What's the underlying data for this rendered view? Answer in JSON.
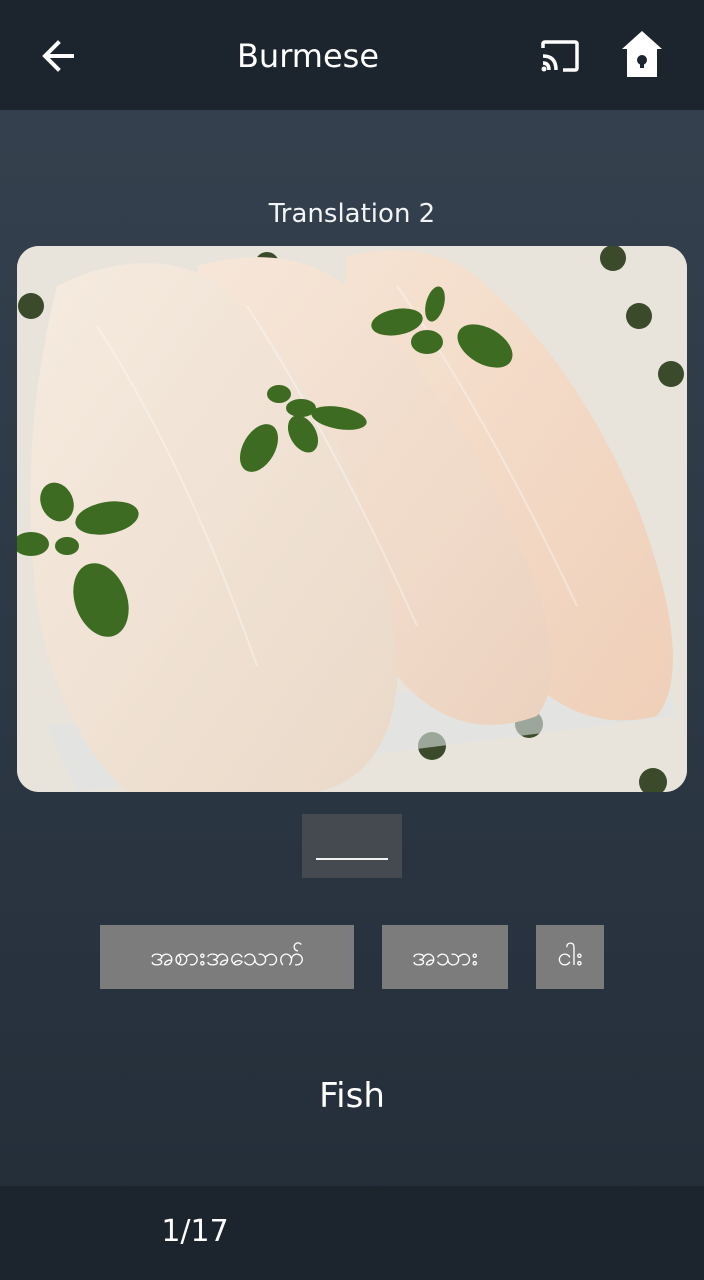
{
  "header": {
    "title": "Burmese",
    "back_icon": "arrow-left-icon",
    "cast_icon": "cast-icon",
    "home_icon": "home-icon"
  },
  "card": {
    "heading": "Translation 2",
    "image_subject": "raw fish fillets with basil leaves",
    "answer_slot": ""
  },
  "choices": [
    {
      "label": "အစားအသောက်"
    },
    {
      "label": "အသား"
    },
    {
      "label": "ငါး"
    }
  ],
  "english_word": "Fish",
  "footer": {
    "page_counter": "1/17"
  },
  "colors": {
    "background": "#2c3744",
    "bar": "#1c242d",
    "choice_button": "#7c7c7c",
    "answer_slot": "#454a50"
  }
}
